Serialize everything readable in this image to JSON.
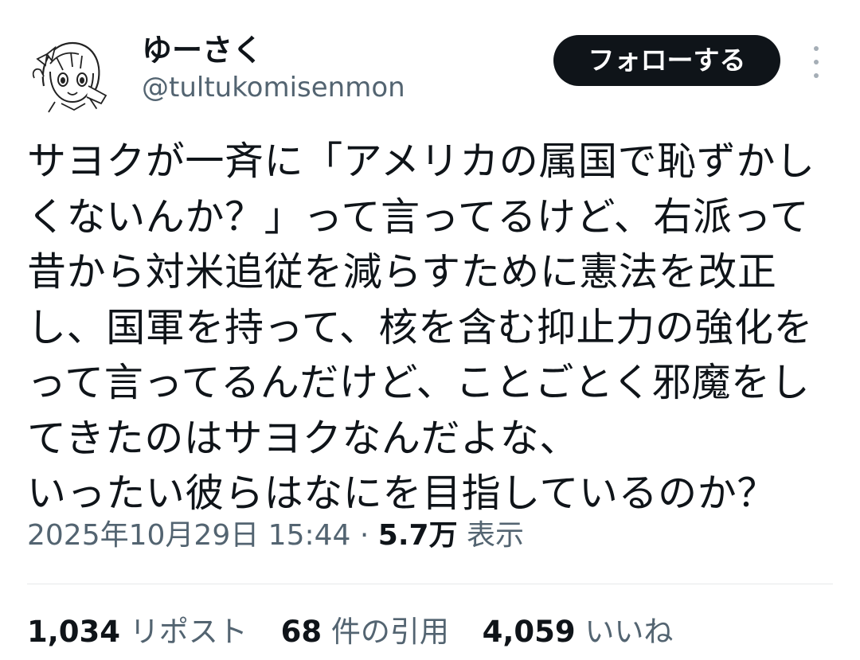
{
  "author": {
    "display_name": "ゆーさく",
    "handle": "@tultukomisenmon",
    "avatar": "anime-girl-sketch-avatar"
  },
  "actions": {
    "follow_label": "フォローする",
    "more_icon": "vertical-ellipsis-icon"
  },
  "tweet": {
    "lines": [
      "サヨクが一斉に「アメリカの属国で恥ずかし",
      "くないんか？」って言ってるけど、右派って",
      "昔から対米追従を減らすために憲法を改正",
      "し、国軍を持って、核を含む抑止力の強化を",
      "って言ってるんだけど、ことごとく邪魔をし",
      "てきたのはサヨクなんだよな、",
      "いったい彼らはなにを目指しているのか？"
    ]
  },
  "meta": {
    "timestamp": "2025年10月29日 15:44",
    "separator": "·",
    "views_count": "5.7万",
    "views_label": "表示"
  },
  "stats": {
    "reposts_count": "1,034",
    "reposts_label": "リポスト",
    "quotes_count": "68",
    "quotes_label": "件の引用",
    "likes_count": "4,059",
    "likes_label": "いいね"
  }
}
